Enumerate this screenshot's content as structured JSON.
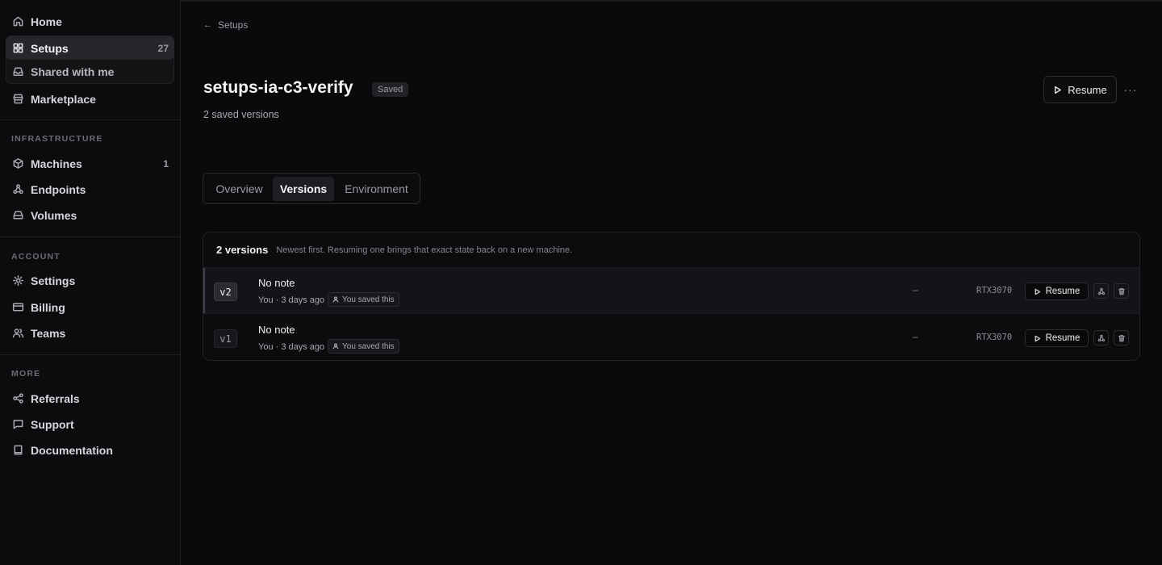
{
  "sidebar": {
    "primary": [
      {
        "label": "Home",
        "icon": "home-icon"
      },
      {
        "label": "Setups",
        "icon": "grid-icon",
        "count": "27"
      },
      {
        "label": "Shared with me",
        "icon": "inbox-icon"
      },
      {
        "label": "Marketplace",
        "icon": "store-icon"
      }
    ],
    "infrastructure_label": "INFRASTRUCTURE",
    "infrastructure": [
      {
        "label": "Machines",
        "icon": "cube-icon",
        "count": "1"
      },
      {
        "label": "Endpoints",
        "icon": "webhook-icon"
      },
      {
        "label": "Volumes",
        "icon": "drive-icon"
      }
    ],
    "account_label": "ACCOUNT",
    "account": [
      {
        "label": "Settings",
        "icon": "gear-icon"
      },
      {
        "label": "Billing",
        "icon": "card-icon"
      },
      {
        "label": "Teams",
        "icon": "users-icon"
      }
    ],
    "more_label": "MORE",
    "more": [
      {
        "label": "Referrals",
        "icon": "share-icon"
      },
      {
        "label": "Support",
        "icon": "chat-icon"
      },
      {
        "label": "Documentation",
        "icon": "book-icon"
      }
    ]
  },
  "page": {
    "back_label": "Setups",
    "title": "setups-ia-c3-verify",
    "badge": "Saved",
    "subtitle": "2 saved versions",
    "resume_label": "Resume",
    "more_label": "···"
  },
  "tabs": [
    {
      "label": "Overview",
      "active": false
    },
    {
      "label": "Versions",
      "active": true
    },
    {
      "label": "Environment",
      "active": false
    }
  ],
  "versions": {
    "count_label": "2 versions",
    "hint": "Newest first. Resuming one brings that exact state back on a new machine.",
    "rows": [
      {
        "tag": "v2",
        "note": "No note",
        "meta": "You · 3 days ago",
        "saved_by": "You saved this",
        "dash": "–",
        "gpu": "RTX3070",
        "resume": "Resume",
        "selected": true
      },
      {
        "tag": "v1",
        "note": "No note",
        "meta": "You · 3 days ago",
        "saved_by": "You saved this",
        "dash": "–",
        "gpu": "RTX3070",
        "resume": "Resume",
        "selected": false
      }
    ]
  }
}
